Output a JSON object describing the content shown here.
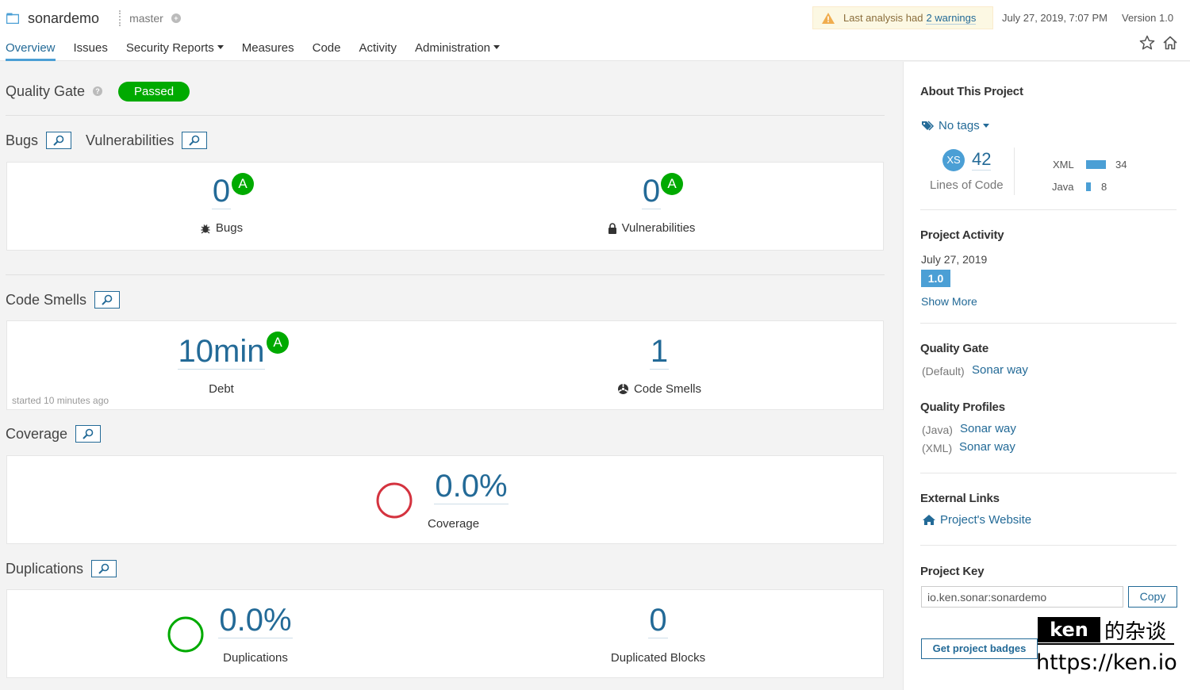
{
  "header": {
    "project_name": "sonardemo",
    "branch": "master",
    "warning_prefix": "Last analysis had",
    "warning_link": "2 warnings",
    "analysis_date": "July 27, 2019, 7:07 PM",
    "version": "Version 1.0"
  },
  "nav": {
    "overview": "Overview",
    "issues": "Issues",
    "security_reports": "Security Reports",
    "measures": "Measures",
    "code": "Code",
    "activity": "Activity",
    "administration": "Administration"
  },
  "quality_gate": {
    "label": "Quality Gate",
    "status": "Passed"
  },
  "sections": {
    "bugs": "Bugs",
    "vulnerabilities": "Vulnerabilities",
    "code_smells": "Code Smells",
    "coverage": "Coverage",
    "duplications": "Duplications"
  },
  "metrics": {
    "bugs": {
      "value": "0",
      "rating": "A",
      "label": "Bugs"
    },
    "vulnerabilities": {
      "value": "0",
      "rating": "A",
      "label": "Vulnerabilities"
    },
    "debt": {
      "value": "10min",
      "rating": "A",
      "label": "Debt"
    },
    "code_smells": {
      "value": "1",
      "label": "Code Smells"
    },
    "started": "started 10 minutes ago",
    "coverage": {
      "value": "0.0%",
      "label": "Coverage"
    },
    "duplications": {
      "value": "0.0%",
      "label": "Duplications"
    },
    "duplicated_blocks": {
      "value": "0",
      "label": "Duplicated Blocks"
    }
  },
  "sidebar": {
    "about_title": "About This Project",
    "tags": "No tags",
    "size_badge": "XS",
    "lines_of_code": "42",
    "lines_of_code_label": "Lines of Code",
    "languages": [
      {
        "name": "XML",
        "lines": "34",
        "fraction": 1.0
      },
      {
        "name": "Java",
        "lines": "8",
        "fraction": 0.235
      }
    ],
    "activity_title": "Project Activity",
    "activity_date": "July 27, 2019",
    "activity_version": "1.0",
    "show_more": "Show More",
    "qg_title": "Quality Gate",
    "qg_default": "(Default)",
    "qg_link": "Sonar way",
    "qp_title": "Quality Profiles",
    "qp_java_lang": "(Java)",
    "qp_java_link": "Sonar way",
    "qp_xml_lang": "(XML)",
    "qp_xml_link": "Sonar way",
    "ext_title": "External Links",
    "ext_link": "Project's Website",
    "key_title": "Project Key",
    "key_value": "io.ken.sonar:sonardemo",
    "copy": "Copy",
    "badges": "Get project badges"
  },
  "watermark": {
    "name": "ken",
    "suffix": "的杂谈",
    "url": "https://ken.io"
  },
  "colors": {
    "accent": "#236a97",
    "accent_light": "#4b9fd5",
    "passed": "#00aa00",
    "coverage_ring": "#d4333f",
    "duplication_ring": "#00aa00"
  }
}
